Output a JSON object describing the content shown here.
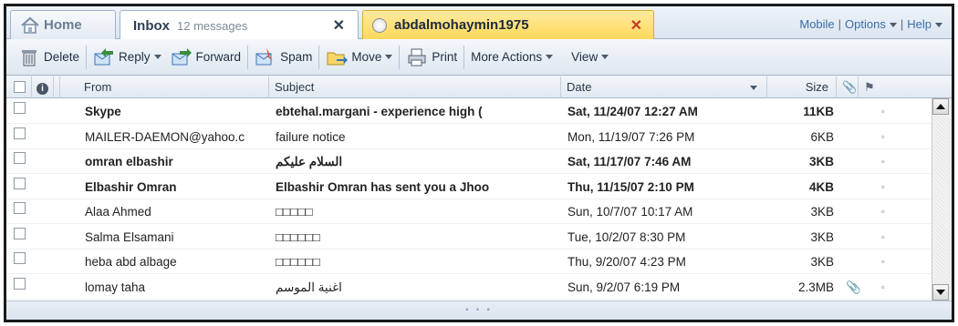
{
  "tabs": {
    "home_label": "Home",
    "inbox_label": "Inbox",
    "inbox_count": "12 messages",
    "message_label": "abdalmohaymin1975"
  },
  "top_links": [
    "Mobile",
    "Options",
    "Help"
  ],
  "toolbar": {
    "delete": "Delete",
    "reply": "Reply",
    "forward": "Forward",
    "spam": "Spam",
    "move": "Move",
    "print": "Print",
    "more_actions": "More Actions",
    "view": "View"
  },
  "columns": {
    "from": "From",
    "subject": "Subject",
    "date": "Date",
    "size": "Size"
  },
  "messages": [
    {
      "from": "Skype",
      "subject": "ebtehal.margani - experience high (",
      "date": "Sat, 11/24/07 12:27 AM",
      "size": "11KB",
      "unread": true,
      "attachment": false
    },
    {
      "from": "MAILER-DAEMON@yahoo.c",
      "subject": "failure notice",
      "date": "Mon, 11/19/07 7:26 PM",
      "size": "6KB",
      "unread": false,
      "attachment": false
    },
    {
      "from": "omran elbashir",
      "subject": "السلام عليكم",
      "date": "Sat, 11/17/07 7:46 AM",
      "size": "3KB",
      "unread": true,
      "attachment": false
    },
    {
      "from": "Elbashir Omran",
      "subject": "Elbashir Omran has sent you a Jhoo",
      "date": "Thu, 11/15/07 2:10 PM",
      "size": "4KB",
      "unread": true,
      "attachment": false
    },
    {
      "from": "Alaa Ahmed",
      "subject": "□□□□□",
      "date": "Sun, 10/7/07 10:17 AM",
      "size": "3KB",
      "unread": false,
      "attachment": false
    },
    {
      "from": "Salma Elsamani",
      "subject": "□□□□□□",
      "date": "Tue, 10/2/07 8:30 PM",
      "size": "3KB",
      "unread": false,
      "attachment": false
    },
    {
      "from": "heba abd albage",
      "subject": "□□□□□□",
      "date": "Thu, 9/20/07 4:23 PM",
      "size": "3KB",
      "unread": false,
      "attachment": false
    },
    {
      "from": "lomay taha",
      "subject": "اغنية الموسم",
      "date": "Sun, 9/2/07 6:19 PM",
      "size": "2.3MB",
      "unread": false,
      "attachment": true
    }
  ]
}
